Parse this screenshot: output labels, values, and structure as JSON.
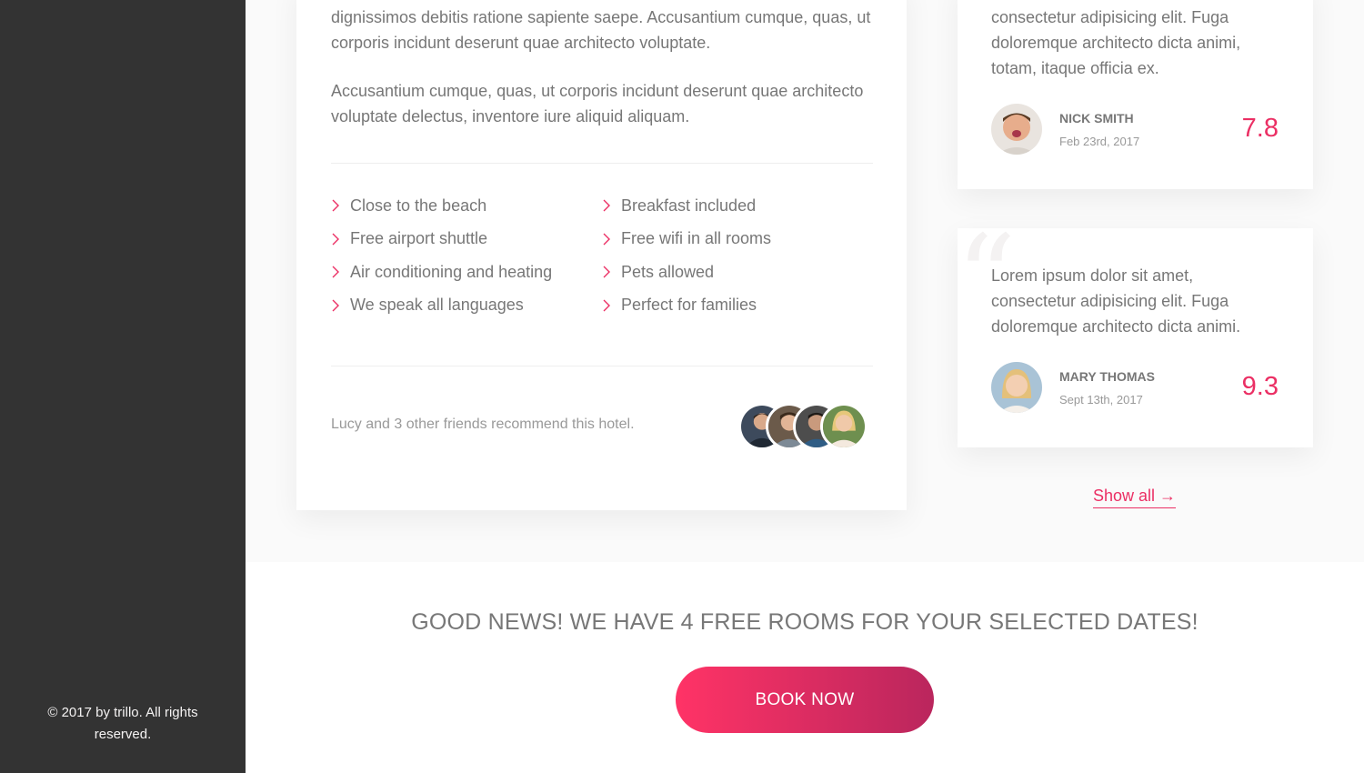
{
  "sidebar": {
    "copyright": "© 2017 by trillo. All rights reserved."
  },
  "detail": {
    "paragraph1": "dignissimos debitis ratione sapiente saepe. Accusantium cumque, quas, ut corporis incidunt deserunt quae architecto voluptate.",
    "paragraph2": "Accusantium cumque, quas, ut corporis incidunt deserunt quae architecto voluptate delectus, inventore iure aliquid aliquam.",
    "features": [
      "Close to the beach",
      "Breakfast included",
      "Free airport shuttle",
      "Free wifi in all rooms",
      "Air conditioning and heating",
      "Pets allowed",
      "We speak all languages",
      "Perfect for families"
    ],
    "recommend_text": "Lucy and 3 other friends recommend this hotel."
  },
  "reviews": [
    {
      "text": "consectetur adipisicing elit. Fuga doloremque architecto dicta animi, totam, itaque officia ex.",
      "name": "Nick Smith",
      "date": "Feb 23rd, 2017",
      "rating": "7.8"
    },
    {
      "text": "Lorem ipsum dolor sit amet, consectetur adipisicing elit. Fuga doloremque architecto dicta animi.",
      "name": "Mary Thomas",
      "date": "Sept 13th, 2017",
      "rating": "9.3"
    }
  ],
  "show_all": "Show all →",
  "cta": {
    "heading": "GOOD NEWS! WE HAVE 4 FREE ROOMS FOR YOUR SELECTED DATES!",
    "button": "BOOK NOW"
  },
  "colors": {
    "accent": "#eb2f64",
    "sidebar_bg": "#333333"
  },
  "icons": {
    "feature_bullet": "chevron-right-icon",
    "quote": "quote-icon"
  }
}
